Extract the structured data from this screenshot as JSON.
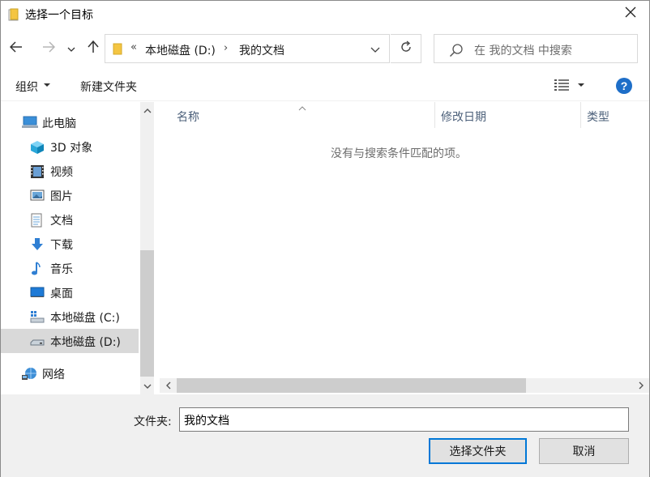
{
  "window": {
    "title": "选择一个目标",
    "title_icon": "folder-icon",
    "close_icon": "close-icon"
  },
  "address_bar": {
    "overflow_chevron": "«",
    "segments": [
      "本地磁盘 (D:)",
      "我的文档"
    ],
    "separator": "›",
    "back_icon": "arrow-left-icon",
    "forward_icon": "arrow-right-icon",
    "recent_icon": "chevron-down-icon",
    "up_icon": "arrow-up-icon",
    "refresh_icon": "refresh-icon"
  },
  "search": {
    "placeholder": "在 我的文档 中搜索"
  },
  "toolbar": {
    "organize": "组织",
    "new_folder": "新建文件夹",
    "view_icon": "details-view-icon",
    "help_label": "?"
  },
  "nav": {
    "items": [
      {
        "label": "此电脑",
        "icon": "computer-icon"
      },
      {
        "label": "3D 对象",
        "icon": "cube-3d-icon"
      },
      {
        "label": "视频",
        "icon": "video-icon"
      },
      {
        "label": "图片",
        "icon": "picture-icon"
      },
      {
        "label": "文档",
        "icon": "document-icon"
      },
      {
        "label": "下载",
        "icon": "download-icon"
      },
      {
        "label": "音乐",
        "icon": "music-icon"
      },
      {
        "label": "桌面",
        "icon": "desktop-icon"
      },
      {
        "label": "本地磁盘 (C:)",
        "icon": "drive-c-icon"
      },
      {
        "label": "本地磁盘 (D:)",
        "icon": "drive-d-icon"
      },
      {
        "label": "网络",
        "icon": "network-icon"
      }
    ],
    "selected": "本地磁盘 (D:)"
  },
  "file_list": {
    "columns": [
      "名称",
      "修改日期",
      "类型"
    ],
    "empty_message": "没有与搜索条件匹配的项。"
  },
  "footer": {
    "folder_label": "文件夹:",
    "folder_value": "我的文档",
    "select_button": "选择文件夹",
    "cancel_button": "取消"
  },
  "colors": {
    "accent": "#0078d7",
    "help": "#1e6ec8",
    "selection": "#d9d9d9",
    "folder": "#f4c542"
  }
}
